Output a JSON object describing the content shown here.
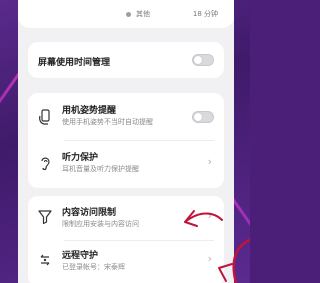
{
  "top": {
    "category": "其他",
    "duration": "18 分钟"
  },
  "screen_time": {
    "label": "屏幕使用时间管理",
    "toggle_on": false
  },
  "posture": {
    "title": "用机姿势提醒",
    "subtitle": "使用手机姿势不当时自动提醒",
    "toggle_on": false
  },
  "hearing": {
    "title": "听力保护",
    "subtitle": "耳机音量及听力保护提醒"
  },
  "content": {
    "title": "内容访问限制",
    "subtitle": "限制应用安装与内容访问"
  },
  "remote": {
    "title": "远程守护",
    "subtitle": "已登录帐号：宋泰辉"
  },
  "colors": {
    "annotation": "#c0143c",
    "background": "#4b1e78"
  },
  "icons": {
    "posture": "phone-hand-icon",
    "hearing": "ear-icon",
    "content": "filter-icon",
    "remote": "remote-guard-icon"
  }
}
